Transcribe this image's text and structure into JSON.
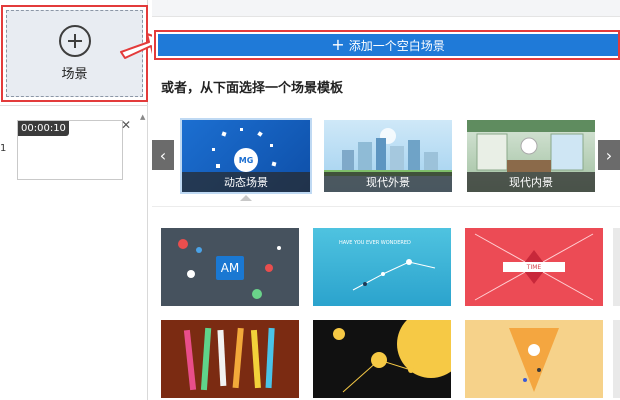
{
  "left_panel": {
    "add_scene_label": "场景",
    "scene_index": "1",
    "scene_time": "00:00:10",
    "close_glyph": "✕"
  },
  "right_panel": {
    "add_empty_button": {
      "plus": "+",
      "label": "添加一个空白场景"
    },
    "choose_heading": "或者，从下面选择一个场景模板",
    "prev_glyph": "‹",
    "next_glyph": "›",
    "scene_types": [
      {
        "label": "动态场景",
        "badge": "MG",
        "selected": true
      },
      {
        "label": "现代外景",
        "selected": false
      },
      {
        "label": "现代内景",
        "selected": false
      }
    ],
    "templates": [
      {
        "badge": "AM",
        "color": "#46525e"
      },
      {
        "text": "HAVE YOU EVER WONDERED",
        "color": "#2ba3cd"
      },
      {
        "ribbon": "TIME",
        "color": "#ec4b55"
      },
      {
        "color": "#7b2b12"
      },
      {
        "color": "#111111"
      },
      {
        "color": "#f6d28a"
      }
    ]
  },
  "colors": {
    "accent_blue": "#1f7ad8",
    "highlight_red": "#e33b3b"
  },
  "icons": {
    "add_scene": "plus-circle-icon",
    "arrow": "arrow-right-icon",
    "close": "close-icon",
    "prev": "chevron-left-icon",
    "next": "chevron-right-icon"
  }
}
